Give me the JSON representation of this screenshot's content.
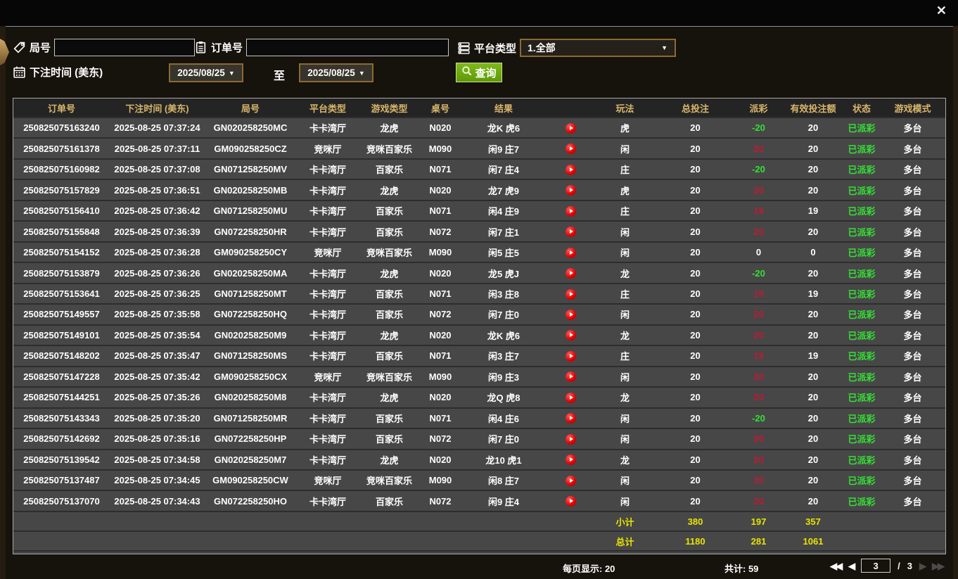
{
  "window": {
    "close_label": "✕"
  },
  "filters": {
    "game_no_label": "局号",
    "game_no_value": "",
    "order_no_label": "订单号",
    "order_no_value": "",
    "platform_label": "平台类型",
    "platform_value": "1.全部",
    "bet_time_label": "下注时间 (美东)",
    "date_from": "2025/08/25",
    "to_label": "至",
    "date_to": "2025/08/25",
    "search_label": "查询"
  },
  "icons": {
    "dropdown_arrow": "▼",
    "pager_first": "◀◀",
    "pager_prev": "◀",
    "pager_next": "▶",
    "pager_last": "▶▶"
  },
  "table": {
    "headers": [
      {
        "key": "order",
        "label": "订单号"
      },
      {
        "key": "time",
        "label": "下注时间 (美东)"
      },
      {
        "key": "game_no",
        "label": "局号"
      },
      {
        "key": "platform",
        "label": "平台类型"
      },
      {
        "key": "game_type",
        "label": "游戏类型"
      },
      {
        "key": "table_no",
        "label": "桌号"
      },
      {
        "key": "result",
        "label": "结果"
      },
      {
        "key": "play_icon",
        "label": ""
      },
      {
        "key": "play",
        "label": "玩法"
      },
      {
        "key": "bet",
        "label": "总投注"
      },
      {
        "key": "payout",
        "label": "派彩"
      },
      {
        "key": "valid",
        "label": "有效投注额"
      },
      {
        "key": "status",
        "label": "状态"
      },
      {
        "key": "mode",
        "label": "游戏模式"
      }
    ],
    "rows": [
      {
        "order": "250825075163240",
        "time": "2025-08-25 07:37:24",
        "game_no": "GN020258250MC",
        "platform": "卡卡湾厅",
        "game_type": "龙虎",
        "table_no": "N020",
        "result": "龙K 虎6",
        "play": "虎",
        "bet": "20",
        "payout": "-20",
        "payout_color": "green",
        "valid": "20",
        "status": "已派彩",
        "mode": "多台"
      },
      {
        "order": "250825075161378",
        "time": "2025-08-25 07:37:11",
        "game_no": "GM090258250CZ",
        "platform": "竞咪厅",
        "game_type": "竞咪百家乐",
        "table_no": "M090",
        "result": "闲9 庄7",
        "play": "闲",
        "bet": "20",
        "payout": "20",
        "payout_color": "red",
        "valid": "20",
        "status": "已派彩",
        "mode": "多台"
      },
      {
        "order": "250825075160982",
        "time": "2025-08-25 07:37:08",
        "game_no": "GN071258250MV",
        "platform": "卡卡湾厅",
        "game_type": "百家乐",
        "table_no": "N071",
        "result": "闲7 庄4",
        "play": "庄",
        "bet": "20",
        "payout": "-20",
        "payout_color": "green",
        "valid": "20",
        "status": "已派彩",
        "mode": "多台"
      },
      {
        "order": "250825075157829",
        "time": "2025-08-25 07:36:51",
        "game_no": "GN020258250MB",
        "platform": "卡卡湾厅",
        "game_type": "龙虎",
        "table_no": "N020",
        "result": "龙7 虎9",
        "play": "虎",
        "bet": "20",
        "payout": "20",
        "payout_color": "red",
        "valid": "20",
        "status": "已派彩",
        "mode": "多台"
      },
      {
        "order": "250825075156410",
        "time": "2025-08-25 07:36:42",
        "game_no": "GN071258250MU",
        "platform": "卡卡湾厅",
        "game_type": "百家乐",
        "table_no": "N071",
        "result": "闲4 庄9",
        "play": "庄",
        "bet": "20",
        "payout": "19",
        "payout_color": "red",
        "valid": "19",
        "status": "已派彩",
        "mode": "多台"
      },
      {
        "order": "250825075155848",
        "time": "2025-08-25 07:36:39",
        "game_no": "GN072258250HR",
        "platform": "卡卡湾厅",
        "game_type": "百家乐",
        "table_no": "N072",
        "result": "闲7 庄1",
        "play": "闲",
        "bet": "20",
        "payout": "20",
        "payout_color": "red",
        "valid": "20",
        "status": "已派彩",
        "mode": "多台"
      },
      {
        "order": "250825075154152",
        "time": "2025-08-25 07:36:28",
        "game_no": "GM090258250CY",
        "platform": "竞咪厅",
        "game_type": "竞咪百家乐",
        "table_no": "M090",
        "result": "闲5 庄5",
        "play": "闲",
        "bet": "20",
        "payout": "0",
        "payout_color": "white",
        "valid": "0",
        "status": "已派彩",
        "mode": "多台"
      },
      {
        "order": "250825075153879",
        "time": "2025-08-25 07:36:26",
        "game_no": "GN020258250MA",
        "platform": "卡卡湾厅",
        "game_type": "龙虎",
        "table_no": "N020",
        "result": "龙5 虎J",
        "play": "龙",
        "bet": "20",
        "payout": "-20",
        "payout_color": "green",
        "valid": "20",
        "status": "已派彩",
        "mode": "多台"
      },
      {
        "order": "250825075153641",
        "time": "2025-08-25 07:36:25",
        "game_no": "GN071258250MT",
        "platform": "卡卡湾厅",
        "game_type": "百家乐",
        "table_no": "N071",
        "result": "闲3 庄8",
        "play": "庄",
        "bet": "20",
        "payout": "19",
        "payout_color": "red",
        "valid": "19",
        "status": "已派彩",
        "mode": "多台"
      },
      {
        "order": "250825075149557",
        "time": "2025-08-25 07:35:58",
        "game_no": "GN072258250HQ",
        "platform": "卡卡湾厅",
        "game_type": "百家乐",
        "table_no": "N072",
        "result": "闲7 庄0",
        "play": "闲",
        "bet": "20",
        "payout": "20",
        "payout_color": "red",
        "valid": "20",
        "status": "已派彩",
        "mode": "多台"
      },
      {
        "order": "250825075149101",
        "time": "2025-08-25 07:35:54",
        "game_no": "GN020258250M9",
        "platform": "卡卡湾厅",
        "game_type": "龙虎",
        "table_no": "N020",
        "result": "龙K 虎6",
        "play": "龙",
        "bet": "20",
        "payout": "20",
        "payout_color": "red",
        "valid": "20",
        "status": "已派彩",
        "mode": "多台"
      },
      {
        "order": "250825075148202",
        "time": "2025-08-25 07:35:47",
        "game_no": "GN071258250MS",
        "platform": "卡卡湾厅",
        "game_type": "百家乐",
        "table_no": "N071",
        "result": "闲3 庄7",
        "play": "庄",
        "bet": "20",
        "payout": "19",
        "payout_color": "red",
        "valid": "19",
        "status": "已派彩",
        "mode": "多台"
      },
      {
        "order": "250825075147228",
        "time": "2025-08-25 07:35:42",
        "game_no": "GM090258250CX",
        "platform": "竞咪厅",
        "game_type": "竞咪百家乐",
        "table_no": "M090",
        "result": "闲9 庄3",
        "play": "闲",
        "bet": "20",
        "payout": "20",
        "payout_color": "red",
        "valid": "20",
        "status": "已派彩",
        "mode": "多台"
      },
      {
        "order": "250825075144251",
        "time": "2025-08-25 07:35:26",
        "game_no": "GN020258250M8",
        "platform": "卡卡湾厅",
        "game_type": "龙虎",
        "table_no": "N020",
        "result": "龙Q 虎8",
        "play": "龙",
        "bet": "20",
        "payout": "20",
        "payout_color": "red",
        "valid": "20",
        "status": "已派彩",
        "mode": "多台"
      },
      {
        "order": "250825075143343",
        "time": "2025-08-25 07:35:20",
        "game_no": "GN071258250MR",
        "platform": "卡卡湾厅",
        "game_type": "百家乐",
        "table_no": "N071",
        "result": "闲4 庄6",
        "play": "闲",
        "bet": "20",
        "payout": "-20",
        "payout_color": "green",
        "valid": "20",
        "status": "已派彩",
        "mode": "多台"
      },
      {
        "order": "250825075142692",
        "time": "2025-08-25 07:35:16",
        "game_no": "GN072258250HP",
        "platform": "卡卡湾厅",
        "game_type": "百家乐",
        "table_no": "N072",
        "result": "闲7 庄0",
        "play": "闲",
        "bet": "20",
        "payout": "20",
        "payout_color": "red",
        "valid": "20",
        "status": "已派彩",
        "mode": "多台"
      },
      {
        "order": "250825075139542",
        "time": "2025-08-25 07:34:58",
        "game_no": "GN020258250M7",
        "platform": "卡卡湾厅",
        "game_type": "龙虎",
        "table_no": "N020",
        "result": "龙10 虎1",
        "play": "龙",
        "bet": "20",
        "payout": "20",
        "payout_color": "red",
        "valid": "20",
        "status": "已派彩",
        "mode": "多台"
      },
      {
        "order": "250825075137487",
        "time": "2025-08-25 07:34:45",
        "game_no": "GM090258250CW",
        "platform": "竞咪厅",
        "game_type": "竞咪百家乐",
        "table_no": "M090",
        "result": "闲8 庄7",
        "play": "闲",
        "bet": "20",
        "payout": "20",
        "payout_color": "red",
        "valid": "20",
        "status": "已派彩",
        "mode": "多台"
      },
      {
        "order": "250825075137070",
        "time": "2025-08-25 07:34:43",
        "game_no": "GN072258250HO",
        "platform": "卡卡湾厅",
        "game_type": "百家乐",
        "table_no": "N072",
        "result": "闲9 庄4",
        "play": "闲",
        "bet": "20",
        "payout": "20",
        "payout_color": "red",
        "valid": "20",
        "status": "已派彩",
        "mode": "多台"
      }
    ],
    "subtotal": {
      "label": "小计",
      "total_bet": "380",
      "payout": "197",
      "valid_bet": "357"
    },
    "grand_total": {
      "label": "总计",
      "total_bet": "1180",
      "payout": "281",
      "valid_bet": "1061"
    }
  },
  "footer": {
    "per_page_label": "每页显示: 20",
    "total_label": "共计: 59",
    "current_page": "3",
    "separator": "/",
    "total_pages": "3"
  },
  "colors": {
    "header_gold": "#d8b66b",
    "payout_win_red": "#bc1b33",
    "payout_loss_green": "#35e035",
    "status_paid_green": "#35e035",
    "totals_yellow": "#e8e400",
    "search_button_green": "#6aa50f",
    "box_border_tan": "#8d6a33"
  }
}
